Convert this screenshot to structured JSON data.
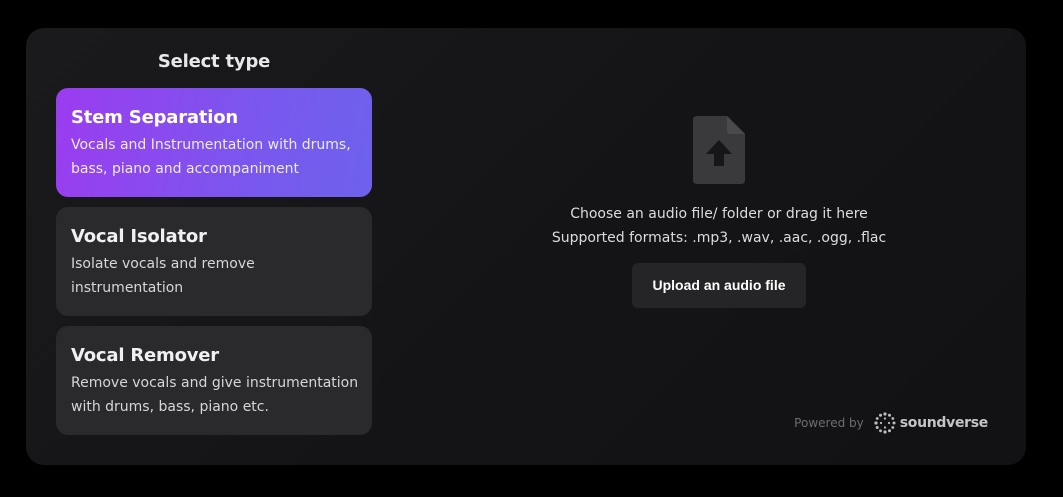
{
  "selector": {
    "title": "Select type",
    "options": [
      {
        "title": "Stem Separation",
        "description": "Vocals and Instrumentation with drums, bass, piano and accompaniment",
        "selected": true
      },
      {
        "title": "Vocal Isolator",
        "description": "Isolate vocals and remove instrumentation",
        "selected": false
      },
      {
        "title": "Vocal Remover",
        "description": "Remove vocals and give instrumentation with drums, bass, piano etc.",
        "selected": false
      }
    ]
  },
  "upload": {
    "icon": "file-upload-icon",
    "line1": "Choose an audio file/ folder or drag it here",
    "line2": "Supported formats: .mp3, .wav, .aac, .ogg, .flac",
    "button_label": "Upload an audio file"
  },
  "footer": {
    "powered_label": "Powered by",
    "brand_name": "soundverse",
    "brand_icon": "soundverse-logo-icon"
  },
  "colors": {
    "page_bg": "#000000",
    "panel_bg": "#161618",
    "card_bg": "#2a2a2c",
    "accent_start": "#9b3cf0",
    "accent_end": "#6d62ec",
    "button_bg": "#252527"
  }
}
